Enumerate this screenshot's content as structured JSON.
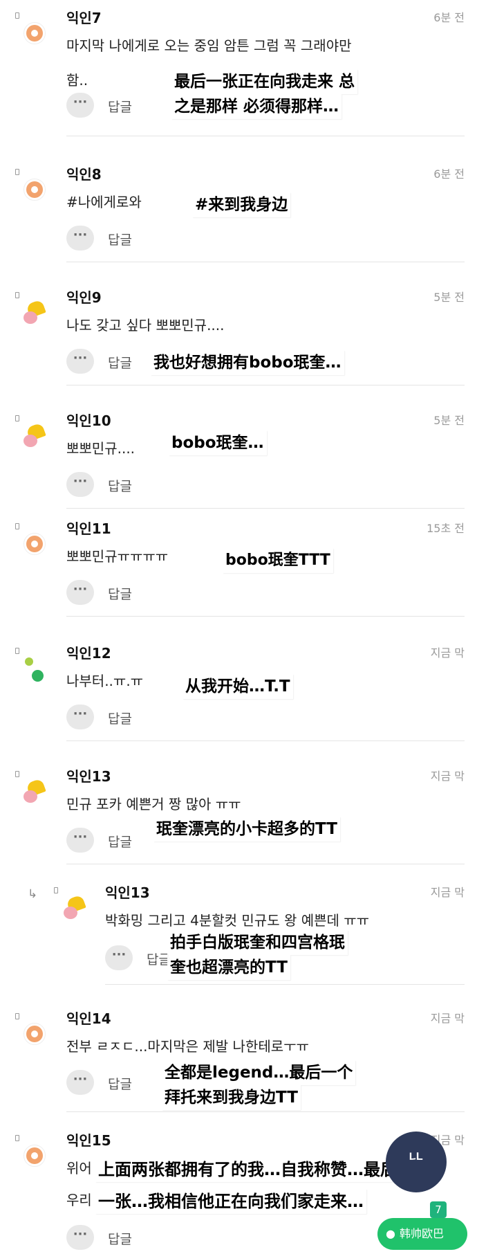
{
  "ui": {
    "reply_label": "답글",
    "more_glyph": "···"
  },
  "comments": [
    {
      "name": "익인7",
      "time": "6분 전",
      "text1": "마지막 나에게로 오는 중임 암튼 그럼 꼭 그래야만",
      "text2": "함..",
      "trans1": "最后一张正在向我走来 总",
      "trans2": "之是那样 必须得那样…"
    },
    {
      "name": "익인8",
      "time": "6분 전",
      "text1": "#나에게로와",
      "trans1": "#来到我身边"
    },
    {
      "name": "익인9",
      "time": "5분 전",
      "text1": "나도 갖고 싶다 뽀뽀민규....",
      "trans1": "我也好想拥有bobo珉奎…"
    },
    {
      "name": "익인10",
      "time": "5분 전",
      "text1": "뽀뽀민규....",
      "trans1": "bobo珉奎…"
    },
    {
      "name": "익인11",
      "time": "15초 전",
      "text1": "뽀뽀민규ㅠㅠㅠㅠ",
      "trans1": "bobo珉奎TTT"
    },
    {
      "name": "익인12",
      "time": "지금 막",
      "text1": "나부터..ㅠ.ㅠ",
      "trans1": "从我开始…T.T"
    },
    {
      "name": "익인13",
      "time": "지금 막",
      "text1": "민규 포카 예쁜거 짱 많아 ㅠㅠ",
      "trans1": "珉奎漂亮的小卡超多的TT"
    },
    {
      "name": "익인13",
      "time": "지금 막",
      "text1": "박화밍 그리고 4분할컷 민규도 왕 예쁜데 ㅠㅠ",
      "trans1": "拍手白版珉奎和四宫格珉",
      "trans2": "奎也超漂亮的TT",
      "reply_label": "답글"
    },
    {
      "name": "익인14",
      "time": "지금 막",
      "text1": "전부 ㄹㅈㄷ...마지막은 제발 나한테로ㅜㅠ",
      "trans1": "全都是legend…最后一个",
      "trans2": "拜托来到我身边TT"
    },
    {
      "name": "익인15",
      "time": "지금 막",
      "text1": "위어",
      "text2": "우리",
      "trans1": "上面两张都拥有了的我…自我称赞…最后",
      "trans2": "一张…我相信他正在向我们家走来…"
    }
  ],
  "fab": {
    "label": "ᄔ"
  },
  "badge": {
    "count": "7"
  },
  "watermark": {
    "text": "韩帅欧巴"
  }
}
